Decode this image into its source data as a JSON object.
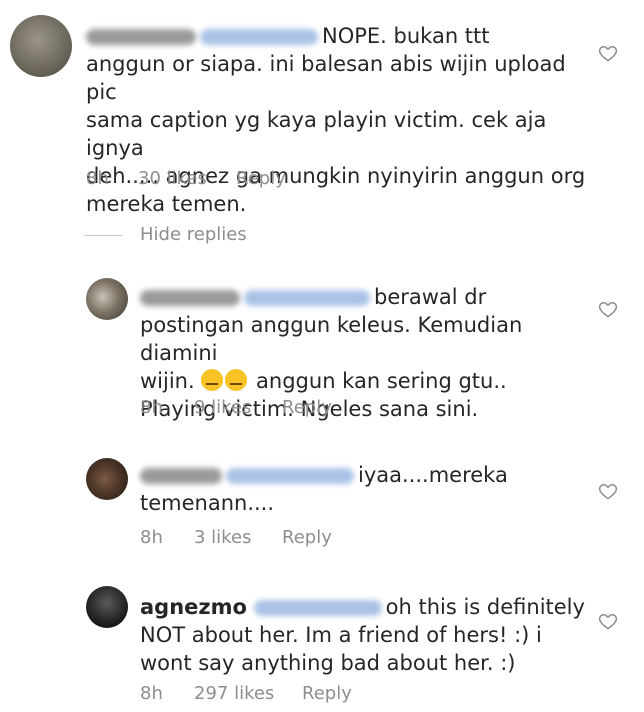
{
  "comments": [
    {
      "username": "",
      "mention": "",
      "text_lines": [
        "NOPE. bukan ttt",
        "anggun or siapa. ini balesan abis wijin upload pic",
        "sama caption yg kaya playin victim. cek aja ignya",
        "deh..... agnez ga mungkin nyinyirin anggun org",
        "mereka temen."
      ],
      "time": "8h",
      "likes": "30 likes",
      "reply": "Reply"
    },
    {
      "username": "",
      "mention": "",
      "text_lines": [
        "berawal dr",
        "postingan anggun keleus. Kemudian diamini",
        "wijin.",
        "anggun kan sering gtu..",
        "Playing victim. Ngeles sana sini."
      ],
      "time": "8h",
      "likes": "9 likes",
      "reply": "Reply"
    },
    {
      "username": "",
      "mention": "",
      "text_lines": [
        "iyaa....mereka",
        "temenann...."
      ],
      "time": "8h",
      "likes": "3 likes",
      "reply": "Reply"
    },
    {
      "username": "agnezmo",
      "mention": "",
      "text_lines": [
        "oh this is definitely",
        "NOT about her. Im a friend of hers! :) i",
        "wont say anything bad about her. :)"
      ],
      "time": "8h",
      "likes": "297 likes",
      "reply": "Reply"
    }
  ],
  "hide_replies": "Hide replies",
  "icons": {
    "like": "heart-icon"
  },
  "colors": {
    "text": "#262626",
    "meta": "#8e8e8e",
    "divider": "#c7c7c7"
  }
}
